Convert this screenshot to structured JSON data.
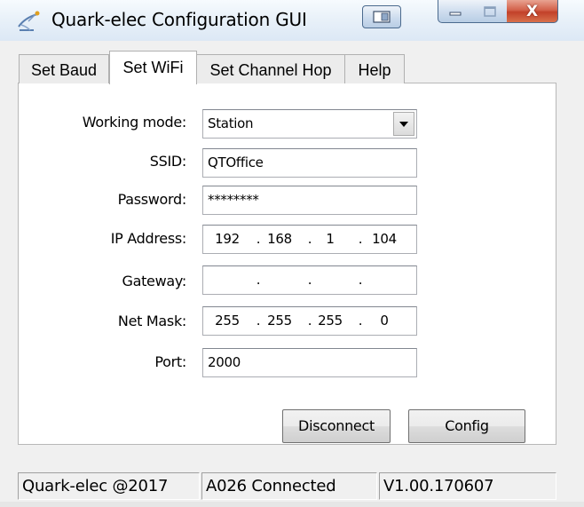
{
  "window": {
    "title": "Quark-elec Configuration GUI",
    "icons": {
      "app": "satellite-dish-icon",
      "extra": "window-layout-icon",
      "minimize": "minimize-icon",
      "maximize": "maximize-icon",
      "close": "close-icon"
    },
    "close_glyph": "X",
    "colors": {
      "close_button": "#c7472e",
      "titlebar": "#dce8f5"
    }
  },
  "tabs": [
    {
      "label": "Set Baud",
      "active": false
    },
    {
      "label": "Set WiFi",
      "active": true
    },
    {
      "label": "Set Channel Hop",
      "active": false
    },
    {
      "label": "Help",
      "active": false
    }
  ],
  "form": {
    "working_mode": {
      "label": "Working mode:",
      "value": "Station",
      "arrow_icon": "dropdown-arrow-icon"
    },
    "ssid": {
      "label": "SSID:",
      "value": "QTOffice"
    },
    "password": {
      "label": "Password:",
      "value": "********"
    },
    "ip_address": {
      "label": "IP Address:",
      "octets": [
        "192",
        "168",
        "1",
        "104"
      ]
    },
    "gateway": {
      "label": "Gateway:",
      "octets": [
        "",
        "",
        "",
        ""
      ]
    },
    "net_mask": {
      "label": "Net Mask:",
      "octets": [
        "255",
        "255",
        "255",
        "0"
      ]
    },
    "port": {
      "label": "Port:",
      "value": "2000"
    },
    "ip_separator": "."
  },
  "buttons": {
    "disconnect": "Disconnect",
    "config": "Config"
  },
  "status_bar": {
    "company": "Quark-elec @2017",
    "connection": "A026 Connected",
    "version": "V1.00.170607"
  }
}
